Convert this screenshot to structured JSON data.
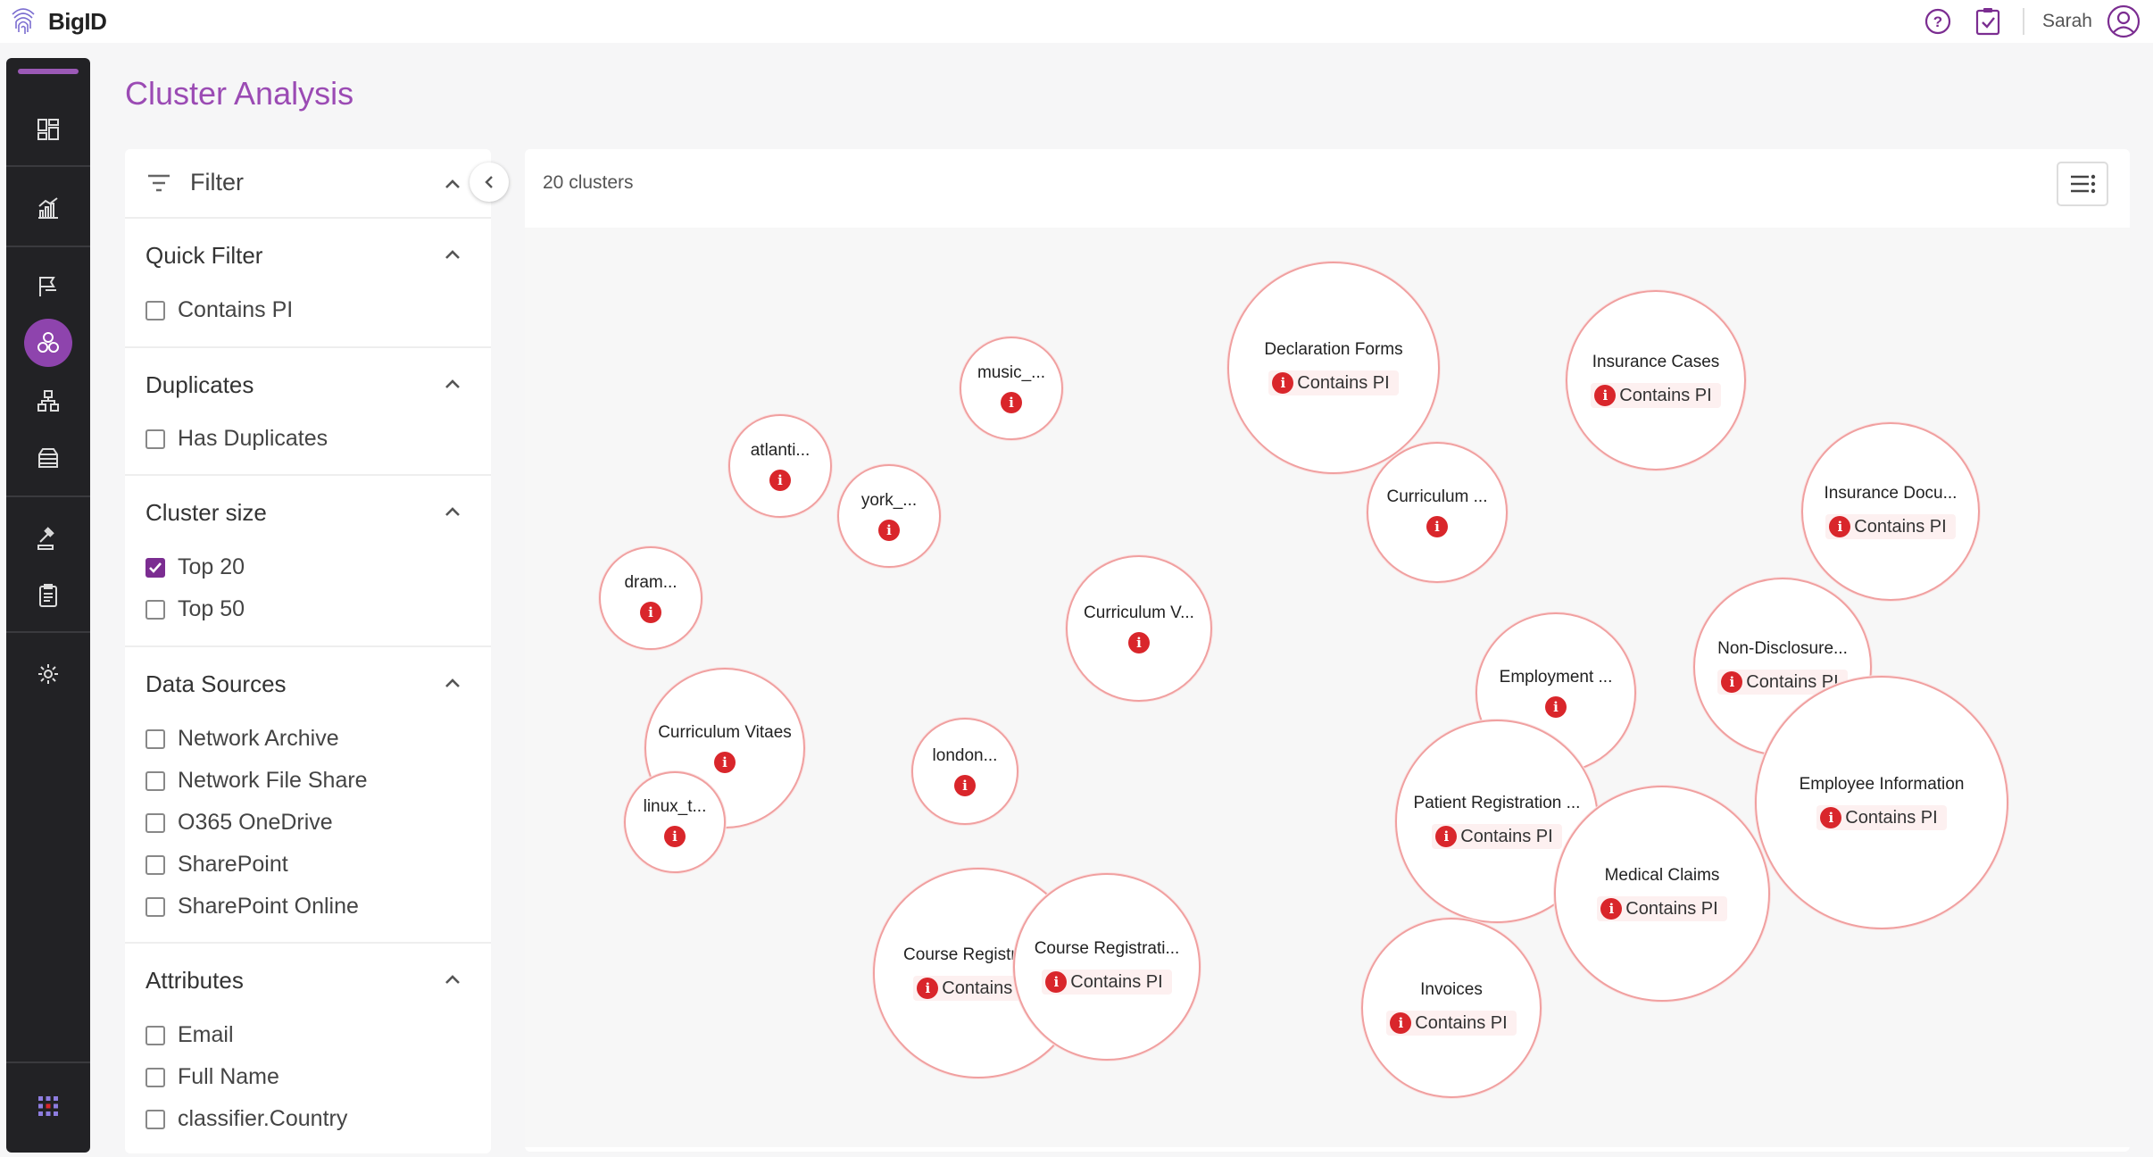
{
  "app": {
    "brand": "BigID",
    "user": "Sarah"
  },
  "page": {
    "title": "Cluster Analysis"
  },
  "filter": {
    "title": "Filter",
    "sections": [
      {
        "title": "Quick Filter",
        "options": [
          {
            "label": "Contains PI",
            "checked": false
          }
        ]
      },
      {
        "title": "Duplicates",
        "options": [
          {
            "label": "Has Duplicates",
            "checked": false
          }
        ]
      },
      {
        "title": "Cluster size",
        "options": [
          {
            "label": "Top 20",
            "checked": true
          },
          {
            "label": "Top 50",
            "checked": false
          }
        ]
      },
      {
        "title": "Data Sources",
        "options": [
          {
            "label": "Network Archive",
            "checked": false
          },
          {
            "label": "Network File Share",
            "checked": false
          },
          {
            "label": "O365 OneDrive",
            "checked": false
          },
          {
            "label": "SharePoint",
            "checked": false
          },
          {
            "label": "SharePoint Online",
            "checked": false
          }
        ]
      },
      {
        "title": "Attributes",
        "options": [
          {
            "label": "Email",
            "checked": false
          },
          {
            "label": "Full Name",
            "checked": false
          },
          {
            "label": "classifier.Country",
            "checked": false
          }
        ]
      }
    ]
  },
  "main": {
    "cluster_count": "20 clusters",
    "pi_badge_label": "Contains PI",
    "pi_icon_glyph": "i",
    "clusters": [
      {
        "name": "Declaration Forms",
        "badge": "Contains PI"
      },
      {
        "name": "Insurance Cases",
        "badge": "Contains PI"
      },
      {
        "name": "music_...",
        "badge": ""
      },
      {
        "name": "atlanti...",
        "badge": ""
      },
      {
        "name": "york_...",
        "badge": ""
      },
      {
        "name": "Curriculum ...",
        "badge": ""
      },
      {
        "name": "Insurance Docu...",
        "badge": "Contains PI"
      },
      {
        "name": "dram...",
        "badge": ""
      },
      {
        "name": "Curriculum V...",
        "badge": ""
      },
      {
        "name": "Non-Disclosure...",
        "badge": "Contains PI"
      },
      {
        "name": "Employment ...",
        "badge": ""
      },
      {
        "name": "Curriculum Vitaes",
        "badge": ""
      },
      {
        "name": "london...",
        "badge": ""
      },
      {
        "name": "linux_t...",
        "badge": ""
      },
      {
        "name": "Patient Registration ...",
        "badge": "Contains PI"
      },
      {
        "name": "Employee Information",
        "badge": "Contains PI"
      },
      {
        "name": "Medical Claims",
        "badge": "Contains PI"
      },
      {
        "name": "Course Registration",
        "badge": "Contains PI"
      },
      {
        "name": "Course Registrati...",
        "badge": "Contains PI"
      },
      {
        "name": "Invoices",
        "badge": "Contains PI"
      }
    ]
  },
  "colors": {
    "accent": "#9b4bb4",
    "nav_bg": "#222225",
    "pi_red": "#d9262b",
    "bubble_border": "#f0a0a0"
  },
  "icons": {
    "nav": [
      "dashboard-icon",
      "analytics-icon",
      "flag-icon",
      "cluster-icon",
      "hierarchy-icon",
      "inventory-icon",
      "gavel-icon",
      "clipboard-icon",
      "settings-icon",
      "apps-grid-icon"
    ],
    "top": [
      "help-icon",
      "tasks-icon",
      "user-avatar-icon"
    ]
  }
}
